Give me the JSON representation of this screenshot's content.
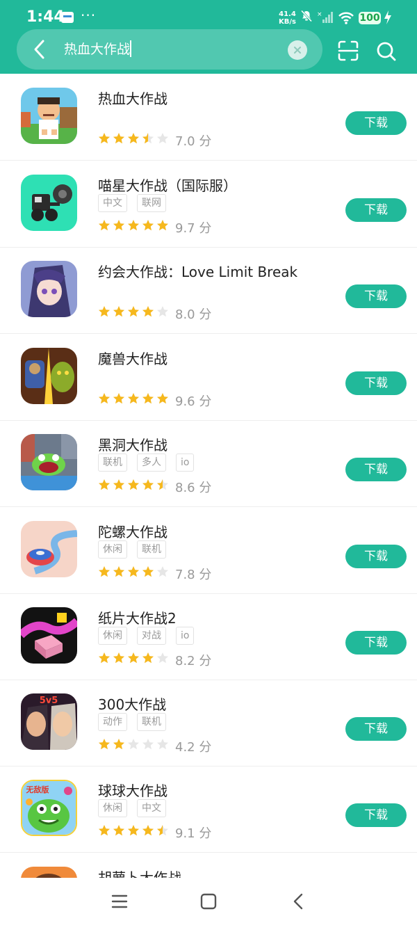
{
  "status_bar": {
    "time": "1:44",
    "more": "···",
    "net_speed_value": "41.4",
    "net_speed_unit": "KB/s",
    "battery": "100"
  },
  "search": {
    "query": "热血大作战",
    "clear_icon": "close-icon",
    "scan_icon": "scan-icon",
    "search_icon": "search-icon"
  },
  "colors": {
    "accent": "#21b99a",
    "star": "#f6b81d",
    "star_empty": "#e6e6e6"
  },
  "apps": [
    {
      "name": "热血大作战",
      "tags": [],
      "rating": 3.5,
      "score": "7.0 分",
      "button": "下载"
    },
    {
      "name": "喵星大作战（国际服）",
      "tags": [
        "中文",
        "联网"
      ],
      "rating": 5,
      "score": "9.7 分",
      "button": "下载"
    },
    {
      "name": "约会大作战：Love Limit Break",
      "tags": [],
      "rating": 4,
      "score": "8.0 分",
      "button": "下载"
    },
    {
      "name": "魔兽大作战",
      "tags": [],
      "rating": 5,
      "score": "9.6 分",
      "button": "下载"
    },
    {
      "name": "黑洞大作战",
      "tags": [
        "联机",
        "多人",
        "io"
      ],
      "rating": 4.5,
      "score": "8.6 分",
      "button": "下载"
    },
    {
      "name": "陀螺大作战",
      "tags": [
        "休闲",
        "联机"
      ],
      "rating": 4,
      "score": "7.8 分",
      "button": "下载"
    },
    {
      "name": "纸片大作战2",
      "tags": [
        "休闲",
        "对战",
        "io"
      ],
      "rating": 4,
      "score": "8.2 分",
      "button": "下载"
    },
    {
      "name": "300大作战",
      "tags": [
        "动作",
        "联机"
      ],
      "rating": 2,
      "score": "4.2 分",
      "button": "下载"
    },
    {
      "name": "球球大作战",
      "tags": [
        "休闲",
        "中文"
      ],
      "rating": 4.5,
      "score": "9.1 分",
      "button": "下载"
    },
    {
      "name": "胡萝卜大作战",
      "tags": [],
      "rating": 0,
      "score": "",
      "button": ""
    }
  ],
  "icon_badges": {
    "app8": "5v5",
    "app9": "无敌版"
  },
  "nav": {
    "menu_icon": "menu-icon",
    "home_icon": "home-icon",
    "back_icon": "back-icon"
  }
}
